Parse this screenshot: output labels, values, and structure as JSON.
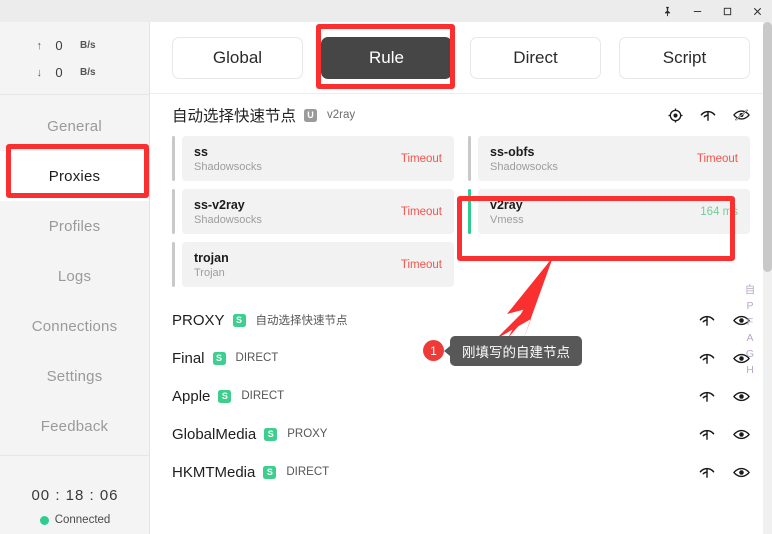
{
  "titlebar": {
    "buttons": [
      {
        "name": "pin-icon",
        "label": "Pin"
      },
      {
        "name": "minimize-icon",
        "label": "Minimize"
      },
      {
        "name": "maximize-icon",
        "label": "Maximize"
      },
      {
        "name": "close-icon",
        "label": "Close"
      }
    ]
  },
  "sidebar": {
    "speed": {
      "upload": {
        "arrow": "↑",
        "value": "0",
        "unit": "B/s"
      },
      "download": {
        "arrow": "↓",
        "value": "0",
        "unit": "B/s"
      }
    },
    "items": [
      {
        "label": "General",
        "active": false
      },
      {
        "label": "Proxies",
        "active": true
      },
      {
        "label": "Profiles",
        "active": false
      },
      {
        "label": "Logs",
        "active": false
      },
      {
        "label": "Connections",
        "active": false
      },
      {
        "label": "Settings",
        "active": false
      },
      {
        "label": "Feedback",
        "active": false
      }
    ],
    "timer": "00 : 18 : 06",
    "status": "Connected",
    "status_color": "#2ecc8f"
  },
  "main": {
    "tabs": [
      {
        "label": "Global",
        "active": false
      },
      {
        "label": "Rule",
        "active": true
      },
      {
        "label": "Direct",
        "active": false
      },
      {
        "label": "Script",
        "active": false
      }
    ],
    "group": {
      "title": "自动选择快速节点",
      "badge": "U",
      "selected": "v2ray",
      "icons": [
        "target-icon",
        "speedtest-icon",
        "eye-off-icon"
      ]
    },
    "nodes": [
      {
        "name": "ss",
        "type": "Shadowsocks",
        "latency": "Timeout",
        "ok": false
      },
      {
        "name": "ss-obfs",
        "type": "Shadowsocks",
        "latency": "Timeout",
        "ok": false
      },
      {
        "name": "ss-v2ray",
        "type": "Shadowsocks",
        "latency": "Timeout",
        "ok": false
      },
      {
        "name": "v2ray",
        "type": "Vmess",
        "latency": "164 ms",
        "ok": true
      },
      {
        "name": "trojan",
        "type": "Trojan",
        "latency": "Timeout",
        "ok": false
      }
    ],
    "proxy_rows": [
      {
        "name": "PROXY",
        "badge": "S",
        "selected": "自动选择快速节点"
      },
      {
        "name": "Final",
        "badge": "S",
        "selected": "DIRECT"
      },
      {
        "name": "Apple",
        "badge": "S",
        "selected": "DIRECT"
      },
      {
        "name": "GlobalMedia",
        "badge": "S",
        "selected": "PROXY"
      },
      {
        "name": "HKMTMedia",
        "badge": "S",
        "selected": "DIRECT"
      }
    ],
    "index_rail": [
      "自",
      "P",
      "F",
      "A",
      "G",
      "H"
    ]
  },
  "annotations": {
    "tooltip_text": "刚填写的自建节点",
    "tooltip_number": "1",
    "highlight_color": "#fa2f2f"
  }
}
